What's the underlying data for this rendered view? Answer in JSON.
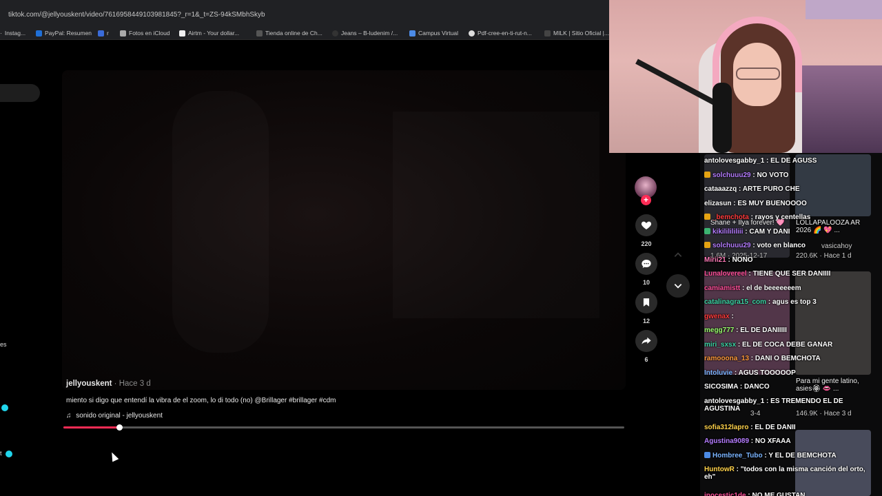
{
  "browser": {
    "url": "tiktok.com/@jellyouskent/video/7616958449103981845?_r=1&_t=ZS-94kSMbhSkyb",
    "bookmarks": [
      "Instag...",
      "PayPal: Resumen",
      "r",
      "Fotos en iCloud",
      "Airtm - Your dollar...",
      "Tienda online de Ch...",
      "Jeans – B-ludenim /...",
      "Campus Virtual",
      "Pdf-cree-en-ti-rut-n...",
      "MILK | Sitio Oficial |..."
    ]
  },
  "sidebar": {
    "partial_label_es": "es",
    "partial_label_t": "t"
  },
  "video": {
    "author": "jellyouskent",
    "posted": "· Hace 3 d",
    "caption": "miento si digo que entendí la vibra de el zoom, lo di todo (no) @Brillager #brillager #cdm",
    "music_icon": "music-note-icon",
    "music": "sonido original - jellyouskent",
    "progress": 0.1
  },
  "actions": {
    "likes": "220",
    "comments": "10",
    "saves": "12",
    "shares": "6"
  },
  "chat": {
    "background_cards": {
      "card1_title": "Shane + Ilya forever! 🩷",
      "card1_meta": "1.6M · 2025-12-17",
      "card2_title": "LOLLAPALOOZA AR 2026 🌈 💖 ...",
      "card2_user": "vasicahoy",
      "card2_meta": "220.6K · Hace 1 d",
      "card3_meta": "3-4",
      "card4_title": "Para mi gente latino, asies🏵 👄 ...",
      "card4_meta": "146.9K · Hace 3 d"
    },
    "messages": [
      {
        "user": "antolovesgabby_1",
        "text": ": EL DE AGUSS",
        "color": "#ffffff"
      },
      {
        "user": "solchuuu29",
        "text": ": NO VOTO",
        "color": "#b57cff"
      },
      {
        "user": "cataaazzq",
        "text": ": ARTE PURO CHE",
        "color": "#ffffff"
      },
      {
        "user": "elizasun",
        "text": ": ES MUY BUENOOOO",
        "color": "#ffffff"
      },
      {
        "user": "_bemchota",
        "text": ": rayos y centellas",
        "color": "#ff3b3b"
      },
      {
        "user": "kikililililiii",
        "text": ": CAM Y DANI",
        "color": "#b57cff"
      },
      {
        "user": "solchuuu29",
        "text": ": voto en blanco",
        "color": "#b57cff"
      },
      {
        "user": "Mirii21",
        "text": ": NONO",
        "color": "#ff7ab8"
      },
      {
        "user": "Lunalovereel",
        "text": ": TIENE QUE SER DANIIII",
        "color": "#ff4f9a"
      },
      {
        "user": "camiamistt",
        "text": ": el de beeeeeeem",
        "color": "#ff4f9a"
      },
      {
        "user": "catalinagra15_com",
        "text": ": agus es top 3",
        "color": "#3cd6a6"
      },
      {
        "user": "gwenax",
        "text": ":",
        "color": "#ff3b3b"
      },
      {
        "user": "megg777",
        "text": ": EL DE DANIIIII",
        "color": "#9bff6e"
      },
      {
        "user": "miri_sxsx",
        "text": ": EL DE COCA DEBE GANAR",
        "color": "#3cd6a6"
      },
      {
        "user": "ramooona_13",
        "text": ": DANI O BEMCHOTA",
        "color": "#ff9a3c"
      },
      {
        "user": "Intoluvie",
        "text": ": AGUS TOOOOOP",
        "color": "#7ab4ff"
      },
      {
        "user": "SICOSIMA",
        "text": ": DANCO",
        "color": "#ffffff"
      },
      {
        "user": "antolovesgabby_1",
        "text": ": ES TREMENDO EL DE AGUSTINA",
        "color": "#ffffff"
      },
      {
        "user": "sofia312lapro",
        "text": ": EL DE DANII",
        "color": "#ffd24a"
      },
      {
        "user": "Agustina9089",
        "text": ": NO XFAAA",
        "color": "#b57cff"
      },
      {
        "user": "Hombree_Tubo",
        "text": ": Y EL DE BEMCHOTA",
        "color": "#7ab4ff"
      },
      {
        "user": "HuntowR",
        "text": ": \"todos con la misma canción del orto, eh\"",
        "color": "#ffd24a"
      },
      {
        "user": "inocestic1de",
        "text": ": NO ME GUSTAN",
        "color": "#ff4f9a"
      }
    ]
  }
}
